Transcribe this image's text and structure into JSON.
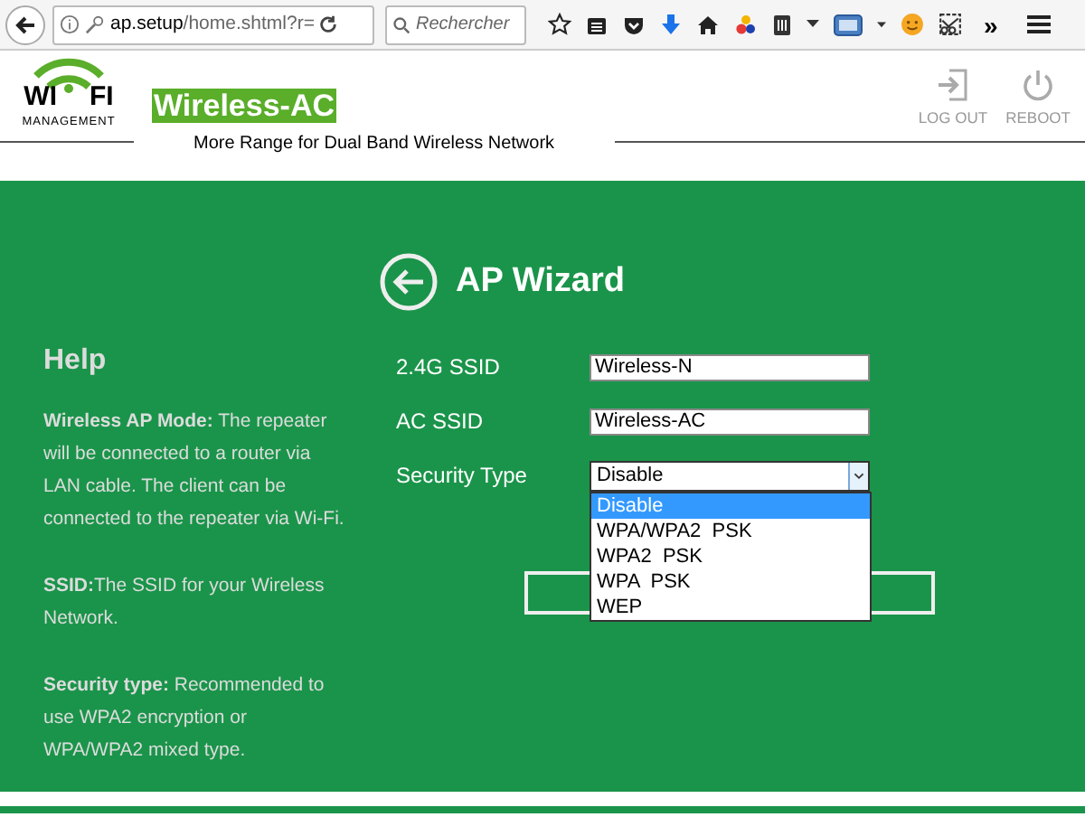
{
  "browser": {
    "url_host": "ap.setup",
    "url_path": "/home.shtml?r=",
    "search_placeholder": "Rechercher",
    "overflow": "»"
  },
  "header": {
    "logo_left": "WI",
    "logo_right": "FI",
    "logo_sub": "MANAGEMENT",
    "brand": "Wireless-AC",
    "tagline": "More Range for Dual Band Wireless Network",
    "actions": [
      {
        "kind": "logout",
        "label": "LOG OUT"
      },
      {
        "kind": "reboot",
        "label": "REBOOT"
      }
    ]
  },
  "help": {
    "title": "Help",
    "paragraphs": [
      "**Wireless AP Mode:** The repeater will be connected to a router via LAN cable. The client can be connected to the repeater via Wi-Fi.",
      "**SSID:**The SSID for your Wireless Network.",
      "**Security type:** Recommended to use WPA2 encryption or WPA/WPA2 mixed type."
    ]
  },
  "wizard": {
    "title": "AP Wizard",
    "fields": [
      {
        "kind": "text",
        "label": "2.4G SSID",
        "value": "Wireless-N"
      },
      {
        "kind": "text",
        "label": "AC SSID",
        "value": "Wireless-AC"
      },
      {
        "kind": "select",
        "label": "Security Type",
        "value": "Disable",
        "expanded": true,
        "options": [
          {
            "label": "Disable",
            "selected": true
          },
          {
            "label": "WPA/WPA2  PSK",
            "selected": false
          },
          {
            "label": "WPA2  PSK",
            "selected": false
          },
          {
            "label": "WPA  PSK",
            "selected": false
          },
          {
            "label": "WEP",
            "selected": false
          }
        ]
      }
    ]
  }
}
